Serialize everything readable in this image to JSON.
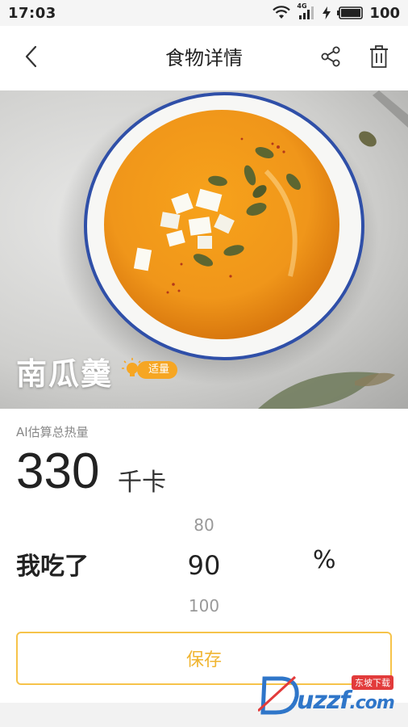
{
  "status_bar": {
    "time": "17:03",
    "network": "4G",
    "battery": "100",
    "icons": [
      "wifi-icon",
      "signal-icon",
      "charging-icon",
      "battery-icon"
    ]
  },
  "nav": {
    "title": "食物详情",
    "back_icon": "chevron-left-icon",
    "share_icon": "share-icon",
    "delete_icon": "trash-icon"
  },
  "food": {
    "name": "南瓜羹",
    "portion_badge": "适量",
    "badge_icon": "lightbulb-icon"
  },
  "calories": {
    "label": "AI估算总热量",
    "value": "330",
    "unit": "千卡"
  },
  "intake": {
    "label": "我吃了",
    "picker_prev": "80",
    "picker_current": "90",
    "picker_next": "100",
    "unit": "%"
  },
  "save_label": "保存",
  "watermark": {
    "text": "uzzf",
    "suffix": ".com",
    "tag": "东坡下载"
  },
  "colors": {
    "accent": "#f6a623",
    "save_border": "#f6c34a",
    "save_text": "#f0b531"
  }
}
